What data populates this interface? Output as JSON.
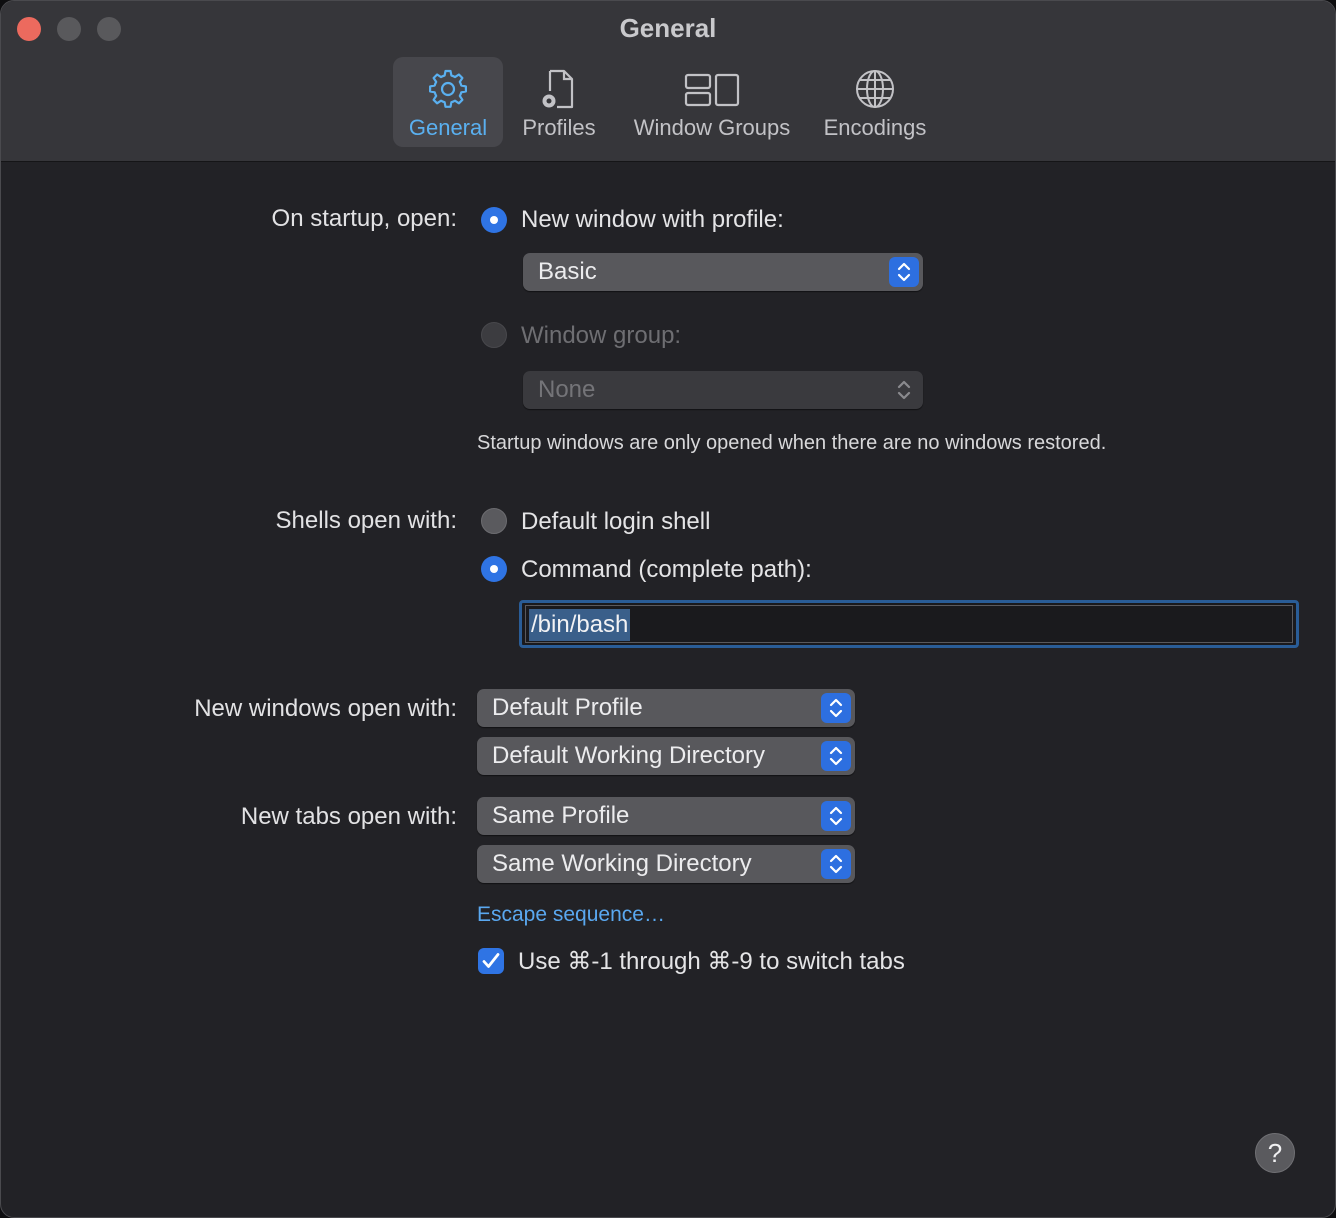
{
  "window": {
    "title": "General"
  },
  "toolbar": {
    "tabs": [
      {
        "label": "General",
        "icon": "gear-icon",
        "selected": true
      },
      {
        "label": "Profiles",
        "icon": "profile-document-icon",
        "selected": false
      },
      {
        "label": "Window Groups",
        "icon": "window-groups-icon",
        "selected": false
      },
      {
        "label": "Encodings",
        "icon": "globe-icon",
        "selected": false
      }
    ]
  },
  "startup": {
    "label": "On startup, open:",
    "option_new_window": "New window with profile:",
    "profile_value": "Basic",
    "option_window_group": "Window group:",
    "group_value": "None",
    "note": "Startup windows are only opened when there are no windows restored."
  },
  "shells": {
    "label": "Shells open with:",
    "option_default": "Default login shell",
    "option_command": "Command (complete path):",
    "command_value": "/bin/bash"
  },
  "new_windows": {
    "label": "New windows open with:",
    "profile_value": "Default Profile",
    "directory_value": "Default Working Directory"
  },
  "new_tabs": {
    "label": "New tabs open with:",
    "profile_value": "Same Profile",
    "directory_value": "Same Working Directory"
  },
  "escape_link": "Escape sequence…",
  "switch_tabs_checkbox": {
    "label": "Use ⌘-1 through ⌘-9 to switch tabs",
    "checked": true
  },
  "help_button": "?",
  "colors": {
    "accent": "#2f74e4",
    "link": "#5aa8f0",
    "selected_tab_text": "#5ab0f0",
    "close_button": "#ec6a5e"
  }
}
